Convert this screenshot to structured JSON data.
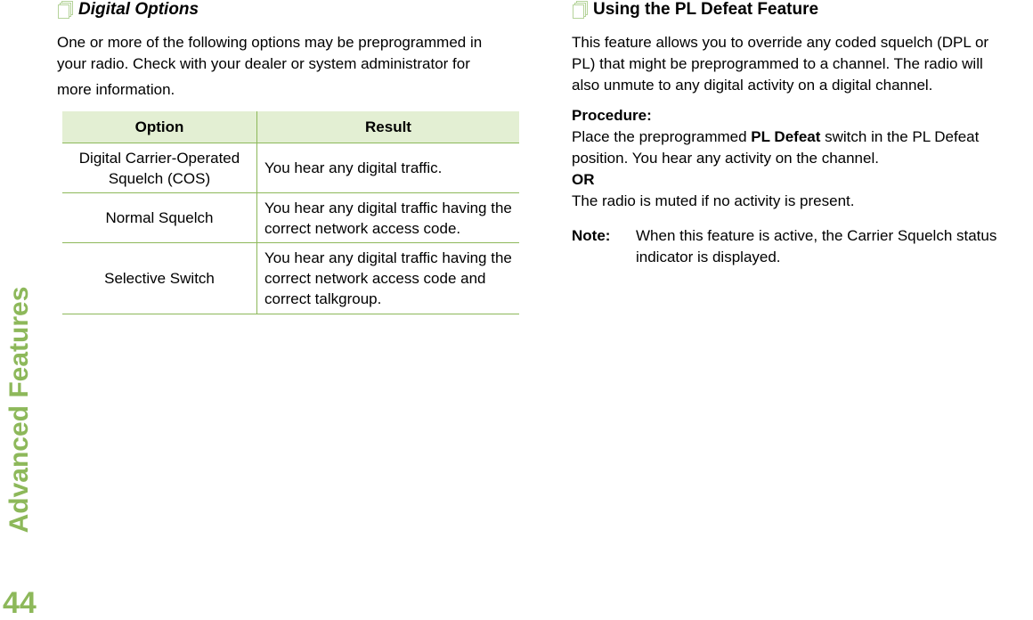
{
  "sidebar": {
    "section": "Advanced Features",
    "page_number": "44"
  },
  "left": {
    "heading_icon": "document-stack-icon",
    "heading": "Digital Options",
    "intro_lines": [
      "One or more of the following options may be preprogrammed in",
      "your radio. Check with your dealer or system administrator for",
      "more information."
    ],
    "table": {
      "headers": [
        "Option",
        "Result"
      ],
      "rows": [
        {
          "option": "Digital Carrier-Operated Squelch (COS)",
          "result": "You hear any digital traffic."
        },
        {
          "option": "Normal Squelch",
          "result": "You hear any digital traffic having the correct network access code."
        },
        {
          "option": "Selective Switch",
          "result": "You hear any digital traffic having the correct network access code and correct talkgroup."
        }
      ]
    }
  },
  "right": {
    "heading_icon": "document-stack-icon",
    "heading": "Using the PL Defeat Feature",
    "intro_lines": [
      "This feature allows you to override any coded squelch (DPL or",
      "PL) that might be preprogrammed to a channel. The radio will",
      "also unmute to any digital activity on a digital channel."
    ],
    "procedure_label": "Procedure:",
    "step_pre": "Place the preprogrammed ",
    "step_bold": "PL Defeat",
    "step_post": " switch in the PL Defeat",
    "step_line2": "position. You hear any activity on the channel.",
    "or_label": "OR",
    "alt_line": "The radio is muted if no activity is present.",
    "note_label": "Note:",
    "note_lines": [
      "When this feature is active, the Carrier Squelch status",
      "indicator is displayed."
    ]
  },
  "colors": {
    "accent": "#8db85a",
    "table_header_bg": "#e3efd3"
  }
}
